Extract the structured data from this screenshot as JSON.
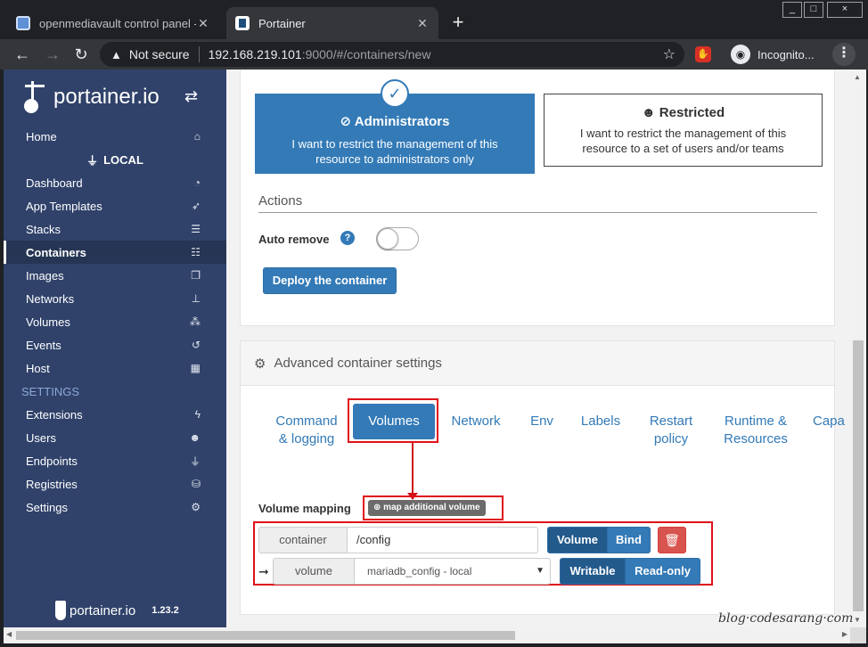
{
  "browser": {
    "tabs": [
      {
        "title": "openmediavault control panel - l",
        "active": false
      },
      {
        "title": "Portainer",
        "active": true
      }
    ],
    "new_tab": "+",
    "window_controls": [
      "_",
      "□",
      "×"
    ],
    "url": {
      "security_label": "Not secure",
      "host": "192.168.219.101",
      "path": ":9000/#/containers/new"
    },
    "profile_label": "Incognito..."
  },
  "sidebar": {
    "logo": "portainer.io",
    "home": {
      "label": "Home",
      "icon": "home-icon"
    },
    "endpoint": "LOCAL",
    "items": [
      {
        "label": "Dashboard",
        "icon": "dashboard-icon",
        "active": false
      },
      {
        "label": "App Templates",
        "icon": "rocket-icon",
        "active": false
      },
      {
        "label": "Stacks",
        "icon": "list-icon",
        "active": false
      },
      {
        "label": "Containers",
        "icon": "server-icon",
        "active": true
      },
      {
        "label": "Images",
        "icon": "clone-icon",
        "active": false
      },
      {
        "label": "Networks",
        "icon": "sitemap-icon",
        "active": false
      },
      {
        "label": "Volumes",
        "icon": "cubes-icon",
        "active": false
      },
      {
        "label": "Events",
        "icon": "history-icon",
        "active": false
      },
      {
        "label": "Host",
        "icon": "th-icon",
        "active": false
      }
    ],
    "settings_heading": "SETTINGS",
    "settings_items": [
      {
        "label": "Extensions",
        "icon": "bolt-icon"
      },
      {
        "label": "Users",
        "icon": "users-icon"
      },
      {
        "label": "Endpoints",
        "icon": "plug-icon"
      },
      {
        "label": "Registries",
        "icon": "database-icon"
      },
      {
        "label": "Settings",
        "icon": "cogs-icon"
      }
    ],
    "footer": {
      "logo": "portainer.io",
      "version": "1.23.2"
    }
  },
  "access_control": {
    "administrators": {
      "title": "Administrators",
      "description": "I want to restrict the management of this resource to administrators only",
      "selected": true
    },
    "restricted": {
      "title": "Restricted",
      "description": "I want to restrict the management of this resource to a set of users and/or teams",
      "selected": false
    }
  },
  "actions": {
    "title": "Actions",
    "auto_remove_label": "Auto remove",
    "auto_remove_enabled": false,
    "deploy_label": "Deploy the container"
  },
  "advanced": {
    "title": "Advanced container settings",
    "tabs": [
      {
        "label": "Command & logging",
        "active": false
      },
      {
        "label": "Volumes",
        "active": true
      },
      {
        "label": "Network",
        "active": false
      },
      {
        "label": "Env",
        "active": false
      },
      {
        "label": "Labels",
        "active": false
      },
      {
        "label": "Restart policy",
        "active": false
      },
      {
        "label": "Runtime & Resources",
        "active": false
      },
      {
        "label": "Capa",
        "active": false
      }
    ],
    "volume_mapping_label": "Volume mapping",
    "map_volume_button": "map additional volume",
    "mapping": {
      "container_label": "container",
      "container_path": "/config",
      "type_options": [
        "Volume",
        "Bind"
      ],
      "type_selected": "Volume",
      "volume_label": "volume",
      "volume_value": "mariadb_config - local",
      "mode_options": [
        "Writable",
        "Read-only"
      ],
      "mode_selected": "Writable"
    }
  },
  "watermark": "blog·codesarang·com",
  "colors": {
    "sidebar_bg": "#30426a",
    "primary": "#337ab7",
    "danger": "#d9534f",
    "highlight_box": "#e0101a"
  }
}
